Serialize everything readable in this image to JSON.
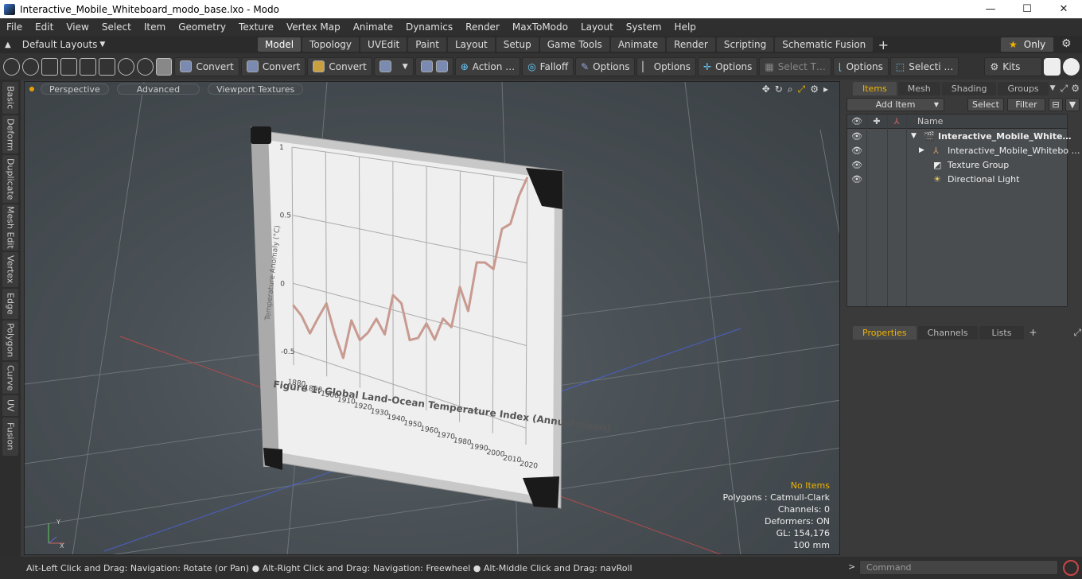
{
  "window": {
    "title": "Interactive_Mobile_Whiteboard_modo_base.lxo - Modo",
    "min": "—",
    "max": "☐",
    "close": "✕"
  },
  "menu": [
    "File",
    "Edit",
    "View",
    "Select",
    "Item",
    "Geometry",
    "Texture",
    "Vertex Map",
    "Animate",
    "Dynamics",
    "Render",
    "MaxToModo",
    "Layout",
    "System",
    "Help"
  ],
  "layout_selector": "Default Layouts",
  "layout_tabs": [
    "Model",
    "Topology",
    "UVEdit",
    "Paint",
    "Layout",
    "Setup",
    "Game Tools",
    "Animate",
    "Render",
    "Scripting",
    "Schematic Fusion"
  ],
  "active_tab": "Model",
  "only_label": "Only",
  "toolbar": {
    "convert1": "Convert",
    "convert2": "Convert",
    "convert3": "Convert",
    "action": "Action …",
    "falloff": "Falloff",
    "options1": "Options",
    "options2": "Options",
    "options3": "Options",
    "options4": "Options",
    "select_t": "Select T…",
    "selecti": "Selecti …",
    "kits": "Kits"
  },
  "left_tabs": [
    "Basic",
    "Deform",
    "Duplicate",
    "Mesh Edit",
    "Vertex",
    "Edge",
    "Polygon",
    "Curve",
    "UV",
    "Fusion"
  ],
  "viewport": {
    "perspective": "Perspective",
    "advanced": "Advanced",
    "viewport_textures": "Viewport Textures",
    "stats": {
      "no_items": "No Items",
      "polygons": "Polygons : Catmull-Clark",
      "channels": "Channels: 0",
      "deformers": "Deformers: ON",
      "gl": "GL: 154,176",
      "scale": "100 mm"
    }
  },
  "whiteboard": {
    "chart_title": "Figure 1: Global Land-Ocean Temperature Index (Annual mean)",
    "y_label": "Temperature Anomaly (°C)",
    "y_ticks": [
      "1",
      "0.5",
      "0",
      "-0.5"
    ],
    "x_ticks": [
      "1880",
      "1890",
      "1900",
      "1910",
      "1920",
      "1930",
      "1940",
      "1950",
      "1960",
      "1970",
      "1980",
      "1990",
      "2000",
      "2010",
      "2020"
    ]
  },
  "chart_data": {
    "type": "line",
    "title": "Figure 1: Global Land-Ocean Temperature Index (Annual mean)",
    "xlabel": "",
    "ylabel": "Temperature Anomaly (°C)",
    "ylim": [
      -0.6,
      1.0
    ],
    "xlim": [
      1880,
      2020
    ],
    "x": [
      1880,
      1885,
      1890,
      1895,
      1900,
      1905,
      1910,
      1915,
      1920,
      1925,
      1930,
      1935,
      1940,
      1945,
      1950,
      1955,
      1960,
      1965,
      1970,
      1975,
      1980,
      1985,
      1990,
      1995,
      2000,
      2005,
      2010,
      2015,
      2020
    ],
    "series": [
      {
        "values": [
          -0.16,
          -0.22,
          -0.33,
          -0.2,
          -0.08,
          -0.28,
          -0.43,
          -0.15,
          -0.27,
          -0.2,
          -0.09,
          -0.18,
          0.1,
          0.06,
          -0.17,
          -0.14,
          -0.03,
          -0.12,
          0.03,
          -0.01,
          0.26,
          0.12,
          0.44,
          0.45,
          0.42,
          0.68,
          0.72,
          0.9,
          1.02
        ]
      }
    ],
    "grid": true
  },
  "items_panel": {
    "tabs": [
      "Items",
      "Mesh …",
      "Shading",
      "Groups"
    ],
    "add_item": "Add Item",
    "select": "Select",
    "filter": "Filter",
    "name_header": "Name",
    "rows": [
      "Interactive_Mobile_White…",
      "Interactive_Mobile_Whitebo …",
      "Texture Group",
      "Directional Light"
    ]
  },
  "props_panel": {
    "tabs": [
      "Properties",
      "Channels",
      "Lists"
    ]
  },
  "statusbar": "Alt-Left Click and Drag: Navigation: Rotate (or Pan) ● Alt-Right Click and Drag: Navigation: Freewheel ● Alt-Middle Click and Drag: navRoll",
  "command": {
    "placeholder": "Command"
  }
}
